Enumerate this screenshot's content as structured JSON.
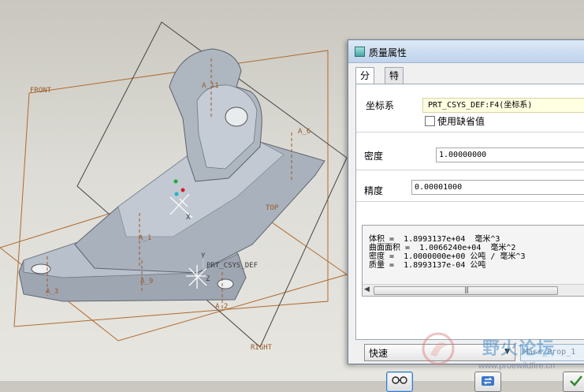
{
  "viewport": {
    "datum_planes": [
      "FRONT",
      "TOP",
      "RIGHT"
    ],
    "axes": [
      "A_11",
      "A_6",
      "A_1",
      "A_9",
      "A_3",
      "A_2"
    ],
    "csys_name": "PRT_CSYS_DEF",
    "csys_axis_labels": [
      "Y",
      "Z",
      "X"
    ]
  },
  "dialog": {
    "title": "质量属性",
    "tabs": [
      {
        "label": "分析",
        "active": true
      },
      {
        "label": "特征",
        "active": false
      }
    ],
    "coord_system": {
      "label": "坐标系",
      "value": "PRT_CSYS_DEF:F4(坐标系)",
      "use_default_label": "使用缺省值",
      "use_default_checked": false
    },
    "density": {
      "label": "密度",
      "value": "1.00000000"
    },
    "accuracy": {
      "label": "精度",
      "value": "0.00001000"
    },
    "results": [
      "体积 =  1.8993137e+04  毫米^3",
      "曲面面积 =  1.0066240e+04  毫米^2",
      "密度 =  1.0000000e+00 公吨 / 毫米^3",
      "质量 =  1.8993137e-04 公吨"
    ],
    "mode_select": {
      "selected": "快速"
    },
    "property_name": {
      "placeholder": "Mass_Prop_1"
    },
    "buttons": [
      {
        "name": "quick-view-button",
        "icon": "glasses-icon"
      },
      {
        "name": "compute-button",
        "icon": "refresh-icon"
      },
      {
        "name": "ok-button",
        "icon": "checkmark-icon"
      }
    ],
    "colors": {
      "titlebar": "#bfd3ec",
      "csys_highlight": "#ffffe1",
      "ok_green": "#2e8b2e"
    }
  },
  "watermark": {
    "title": "野火论坛",
    "url": "www.proewildfire.cn"
  }
}
